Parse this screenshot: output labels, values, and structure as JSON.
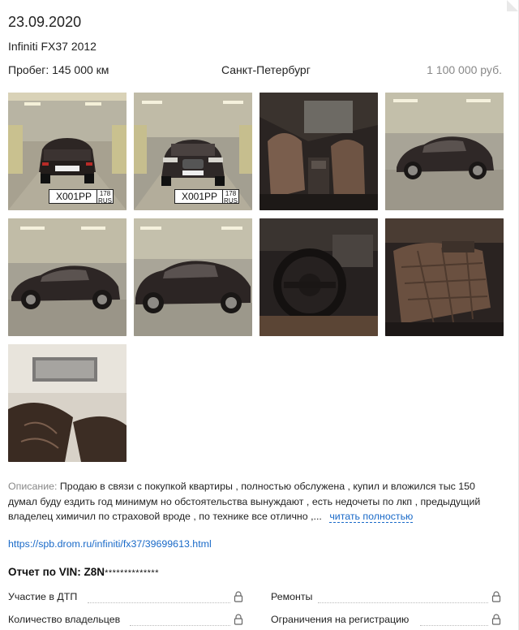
{
  "listing": {
    "date": "23.09.2020",
    "title": "Infiniti FX37 2012",
    "mileage": "Пробег: 145 000 км",
    "city": "Санкт-Петербург",
    "price": "1 100 000 руб."
  },
  "photos": [
    {
      "scene": "car-rear-parking",
      "plate": "Х001РР",
      "region": "178"
    },
    {
      "scene": "car-front-parking",
      "plate": "Х001РР",
      "region": "178"
    },
    {
      "scene": "interior-front-seats"
    },
    {
      "scene": "car-side-parking"
    },
    {
      "scene": "car-side-parking-2"
    },
    {
      "scene": "car-side-parking-3"
    },
    {
      "scene": "steering-wheel"
    },
    {
      "scene": "rear-seats"
    },
    {
      "scene": "sunroof-ceiling"
    }
  ],
  "description": {
    "label": "Описание:",
    "text": "Продаю в связи с покупкой квартиры , полностью обслужена , купил и вложился тыс 150 думал буду ездить год минимум но обстоятельства вынуждают , есть недочеты по лкп , предыдущий владелец химичил по страховой вроде , по технике все отлично ,...",
    "read_more": "читать полностью"
  },
  "source_link": "https://spb.drom.ru/infiniti/fx37/39699613.html",
  "vin_report": {
    "title": "Отчет по VIN: Z8N",
    "mask": "**************",
    "items": [
      "Участие в ДТП",
      "Ремонты",
      "Количество владельцев",
      "Ограничения на регистрацию"
    ]
  },
  "colors": {
    "link": "#1a6ac8",
    "muted": "#888888"
  }
}
